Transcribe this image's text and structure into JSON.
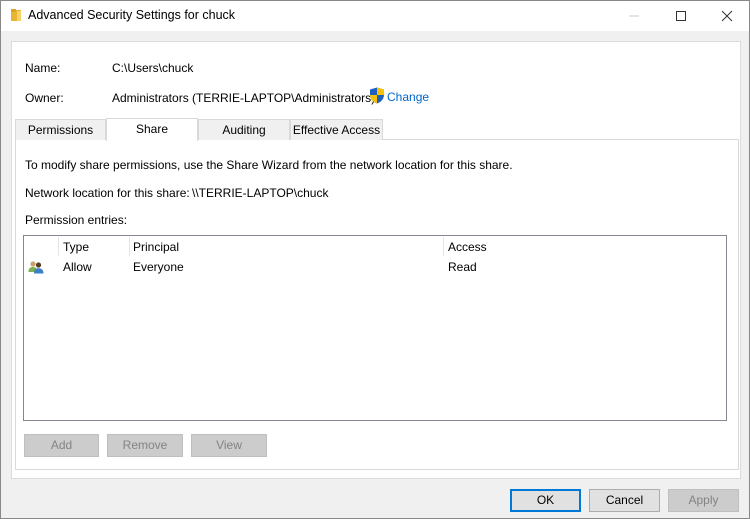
{
  "window": {
    "title": "Advanced Security Settings for chuck",
    "controls": {
      "minimize": "minimize",
      "maximize": "maximize",
      "close": "close"
    }
  },
  "header": {
    "name_label": "Name:",
    "name_value": "C:\\Users\\chuck",
    "owner_label": "Owner:",
    "owner_value": "Administrators (TERRIE-LAPTOP\\Administrators)",
    "change_link": "Change"
  },
  "tabs": [
    {
      "label": "Permissions",
      "active": false
    },
    {
      "label": "Share",
      "active": true
    },
    {
      "label": "Auditing",
      "active": false
    },
    {
      "label": "Effective Access",
      "active": false
    }
  ],
  "share": {
    "info_text": "To modify share permissions, use the Share Wizard from the network location for this share.",
    "network_location_label": "Network location for this share:",
    "network_location_value": "\\\\TERRIE-LAPTOP\\chuck",
    "entries_label": "Permission entries:",
    "columns": [
      "Type",
      "Principal",
      "Access"
    ],
    "rows": [
      {
        "icon": "user-group-icon",
        "type": "Allow",
        "principal": "Everyone",
        "access": "Read"
      }
    ],
    "buttons": {
      "add": "Add",
      "remove": "Remove",
      "view": "View"
    }
  },
  "footer": {
    "ok": "OK",
    "cancel": "Cancel",
    "apply": "Apply"
  },
  "colors": {
    "link": "#0066cc",
    "default_button_border": "#0078d7",
    "disabled_text": "#838383"
  }
}
